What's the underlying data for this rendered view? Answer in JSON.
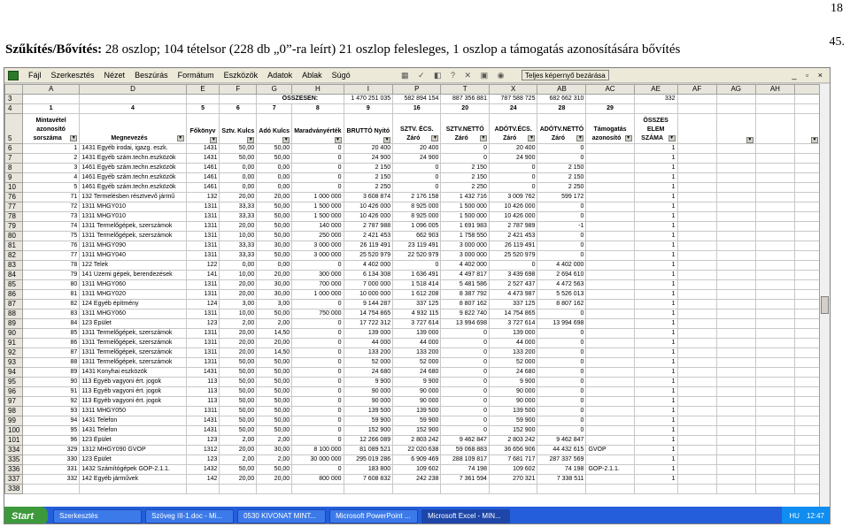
{
  "page": {
    "number": "18",
    "slide_number": "45."
  },
  "title": {
    "bold": "Szűkítés/Bővítés:",
    "rest": " 28 oszlop; 104 tételsor (228 db „0”-ra leírt) 21 oszlop felesleges, 1 oszlop a támogatás azonosítására bővítés"
  },
  "excel": {
    "menu": [
      "Fájl",
      "Szerkesztés",
      "Nézet",
      "Beszúrás",
      "Formátum",
      "Eszközök",
      "Adatok",
      "Ablak",
      "Súgó"
    ],
    "fullscreen_label": "Teljes képernyő bezárása",
    "window_controls": "_ ▫ ×",
    "columns": [
      "A",
      "D",
      "E",
      "F",
      "G",
      "H",
      "I",
      "P",
      "T",
      "X",
      "AB",
      "AC",
      "AE",
      "AF",
      "AG",
      "AH"
    ],
    "row3": {
      "rowhdr": "3",
      "label": "ÖSSZESEN:",
      "vals": [
        "1 470 251 035",
        "582 894 154",
        "887 356 881",
        "787 588 725",
        "682 662 310",
        "",
        "332"
      ]
    },
    "row4": {
      "rowhdr": "4",
      "vals": [
        "1",
        "4",
        "5",
        "6",
        "7",
        "8",
        "9",
        "16",
        "20",
        "24",
        "28",
        "29"
      ]
    },
    "header_row": {
      "rowhdr": "5",
      "cells": [
        "Mintavétel azonosító sorszáma",
        "Megnevezés",
        "Főkönyv",
        "Sztv. Kulcs",
        "Adó Kulcs",
        "Maradványérték",
        "BRUTTÓ Nyitó",
        "SZTV. ÉCS. Záró",
        "SZTV.NETTÓ Záró",
        "ADÓTV.ÉCS. Záró",
        "ADÓTV.NETTÓ Záró",
        "Támogatás azonosító",
        "ÖSSZES ELEM SZÁMA"
      ]
    },
    "rows": [
      [
        "6",
        "1",
        "1431 Egyéb irodai, igazg. eszk.",
        "1431",
        "50,00",
        "50,00",
        "0",
        "20 400",
        "20 400",
        "0",
        "20 400",
        "0",
        "",
        "1"
      ],
      [
        "7",
        "2",
        "1431 Egyéb szám.techn.eszközök",
        "1431",
        "50,00",
        "50,00",
        "0",
        "24 900",
        "24 900",
        "0",
        "24 900",
        "0",
        "",
        "1"
      ],
      [
        "8",
        "3",
        "1461 Egyéb szám.techn.eszközök",
        "1461",
        "0,00",
        "0,00",
        "0",
        "2 150",
        "0",
        "2 150",
        "0",
        "2 150",
        "",
        "1"
      ],
      [
        "9",
        "4",
        "1461 Egyéb szám.techn.eszközök",
        "1461",
        "0,00",
        "0,00",
        "0",
        "2 150",
        "0",
        "2 150",
        "0",
        "2 150",
        "",
        "1"
      ],
      [
        "10",
        "5",
        "1461 Egyéb szám.techn.eszközök",
        "1461",
        "0,00",
        "0,00",
        "0",
        "2 250",
        "0",
        "2 250",
        "0",
        "2 250",
        "",
        "1"
      ],
      [
        "76",
        "71",
        "132 Termelésben résztvevő jármű",
        "132",
        "20,00",
        "20,00",
        "1 000 000",
        "3 608 874",
        "2 176 158",
        "1 432 716",
        "3 009 762",
        "599 172",
        "",
        "1"
      ],
      [
        "77",
        "72",
        "1311 MHGY010",
        "1311",
        "33,33",
        "50,00",
        "1 500 000",
        "10 426 000",
        "8 925 000",
        "1 500 000",
        "10 426 000",
        "0",
        "",
        "1"
      ],
      [
        "78",
        "73",
        "1311 MHGY010",
        "1311",
        "33,33",
        "50,00",
        "1 500 000",
        "10 426 000",
        "8 925 000",
        "1 500 000",
        "10 426 000",
        "0",
        "",
        "1"
      ],
      [
        "79",
        "74",
        "1311 Termelőgépek, szerszámok",
        "1311",
        "20,00",
        "50,00",
        "140 000",
        "2 787 988",
        "1 096 005",
        "1 691 983",
        "2 787 989",
        "-1",
        "",
        "1"
      ],
      [
        "80",
        "75",
        "1311 Termelőgépek, szerszámok",
        "1311",
        "10,00",
        "50,00",
        "250 000",
        "2 421 453",
        "662 903",
        "1 758 550",
        "2 421 453",
        "0",
        "",
        "1"
      ],
      [
        "81",
        "76",
        "1311 MHGY090",
        "1311",
        "33,33",
        "30,00",
        "3 000 000",
        "26 119 491",
        "23 119 491",
        "3 000 000",
        "26 119 491",
        "0",
        "",
        "1"
      ],
      [
        "82",
        "77",
        "1311 MHGY040",
        "1311",
        "33,33",
        "50,00",
        "3 000 000",
        "25 520 979",
        "22 520 979",
        "3 000 000",
        "25 520 979",
        "0",
        "",
        "1"
      ],
      [
        "83",
        "78",
        "122 Telek",
        "122",
        "0,00",
        "0,00",
        "0",
        "4 402 000",
        "0",
        "4 402 000",
        "0",
        "4 402 000",
        "",
        "1"
      ],
      [
        "84",
        "79",
        "141 Üzemi gépek, berendezések",
        "141",
        "10,00",
        "20,00",
        "300 000",
        "6 134 308",
        "1 636 491",
        "4 497 817",
        "3 439 698",
        "2 694 610",
        "",
        "1"
      ],
      [
        "85",
        "80",
        "1311 MHGY060",
        "1311",
        "20,00",
        "30,00",
        "700 000",
        "7 000 000",
        "1 518 414",
        "5 481 586",
        "2 527 437",
        "4 472 563",
        "",
        "1"
      ],
      [
        "86",
        "81",
        "1311 MHGY020",
        "1311",
        "20,00",
        "30,00",
        "1 000 000",
        "10 000 000",
        "1 612 208",
        "8 387 792",
        "4 473 987",
        "5 526 013",
        "",
        "1"
      ],
      [
        "87",
        "82",
        "124 Egyéb építmény",
        "124",
        "3,00",
        "3,00",
        "0",
        "9 144 287",
        "337 125",
        "8 807 162",
        "337 125",
        "8 807 162",
        "",
        "1"
      ],
      [
        "88",
        "83",
        "1311 MHGY060",
        "1311",
        "10,00",
        "50,00",
        "750 000",
        "14 754 865",
        "4 932 115",
        "9 822 740",
        "14 754 865",
        "0",
        "",
        "1"
      ],
      [
        "89",
        "84",
        "123 Épület",
        "123",
        "2,00",
        "2,00",
        "0",
        "17 722 312",
        "3 727 614",
        "13 994 698",
        "3 727 614",
        "13 994 698",
        "",
        "1"
      ],
      [
        "90",
        "85",
        "1311 Termelőgépek, szerszámok",
        "1311",
        "20,00",
        "14,50",
        "0",
        "139 000",
        "139 000",
        "0",
        "139 000",
        "0",
        "",
        "1"
      ],
      [
        "91",
        "86",
        "1311 Termelőgépek, szerszámok",
        "1311",
        "20,00",
        "20,00",
        "0",
        "44 000",
        "44 000",
        "0",
        "44 000",
        "0",
        "",
        "1"
      ],
      [
        "92",
        "87",
        "1311 Termelőgépek, szerszámok",
        "1311",
        "20,00",
        "14,50",
        "0",
        "133 200",
        "133 200",
        "0",
        "133 200",
        "0",
        "",
        "1"
      ],
      [
        "93",
        "88",
        "1311 Termelőgépek, szerszámok",
        "1311",
        "50,00",
        "50,00",
        "0",
        "52 000",
        "52 000",
        "0",
        "52 000",
        "0",
        "",
        "1"
      ],
      [
        "94",
        "89",
        "1431 Konyhai eszközök",
        "1431",
        "50,00",
        "50,00",
        "0",
        "24 680",
        "24 680",
        "0",
        "24 680",
        "0",
        "",
        "1"
      ],
      [
        "95",
        "90",
        "113 Egyéb vagyoni ért. jogok",
        "113",
        "50,00",
        "50,00",
        "0",
        "9 900",
        "9 900",
        "0",
        "9 900",
        "0",
        "",
        "1"
      ],
      [
        "96",
        "91",
        "113 Egyéb vagyoni ért. jogok",
        "113",
        "50,00",
        "50,00",
        "0",
        "90 000",
        "90 000",
        "0",
        "90 000",
        "0",
        "",
        "1"
      ],
      [
        "97",
        "92",
        "113 Egyéb vagyoni ért. jogok",
        "113",
        "50,00",
        "50,00",
        "0",
        "90 000",
        "90 000",
        "0",
        "90 000",
        "0",
        "",
        "1"
      ],
      [
        "98",
        "93",
        "1311 MHGY050",
        "1311",
        "50,00",
        "50,00",
        "0",
        "139 500",
        "139 500",
        "0",
        "139 500",
        "0",
        "",
        "1"
      ],
      [
        "99",
        "94",
        "1431 Telefon",
        "1431",
        "50,00",
        "50,00",
        "0",
        "59 900",
        "59 900",
        "0",
        "59 900",
        "0",
        "",
        "1"
      ],
      [
        "100",
        "95",
        "1431 Telefon",
        "1431",
        "50,00",
        "50,00",
        "0",
        "152 900",
        "152 900",
        "0",
        "152 900",
        "0",
        "",
        "1"
      ],
      [
        "101",
        "96",
        "123 Épület",
        "123",
        "2,00",
        "2,00",
        "0",
        "12 266 089",
        "2 803 242",
        "9 462 847",
        "2 803 242",
        "9 462 847",
        "",
        "1"
      ],
      [
        "334",
        "329",
        "1312 MHGY090 GVOP",
        "1312",
        "20,00",
        "30,00",
        "8 100 000",
        "81 089 521",
        "22 020 638",
        "59 068 883",
        "36 656 906",
        "44 432 615",
        "GVOP",
        "1"
      ],
      [
        "335",
        "330",
        "123 Épület",
        "123",
        "2,00",
        "2,00",
        "30 000 000",
        "295 019 286",
        "6 909 469",
        "288 109 817",
        "7 681 717",
        "287 337 569",
        "",
        "1"
      ],
      [
        "336",
        "331",
        "1432 Számítógépek GOP-2.1.1.",
        "1432",
        "50,00",
        "50,00",
        "0",
        "183 800",
        "109 602",
        "74 198",
        "109 602",
        "74 198",
        "GOP-2.1.1.",
        "1"
      ],
      [
        "337",
        "332",
        "142 Egyéb járművek",
        "142",
        "20,00",
        "20,00",
        "800 000",
        "7 608 832",
        "242 238",
        "7 361 594",
        "270 321",
        "7 338 511",
        "",
        "1"
      ],
      [
        "338",
        "",
        "",
        "",
        "",
        "",
        "",
        "",
        "",
        "",
        "",
        "",
        "",
        ""
      ]
    ]
  },
  "taskbar": {
    "start": "Start",
    "tasks": [
      "Szerkesztés",
      "Szöveg III-1.doc - Mi...",
      "0530 KIVONAT MINT...",
      "Microsoft PowerPoint ...",
      "Microsoft Excel - MIN..."
    ],
    "active_index": 4,
    "lang": "HU",
    "time": "12:47"
  }
}
